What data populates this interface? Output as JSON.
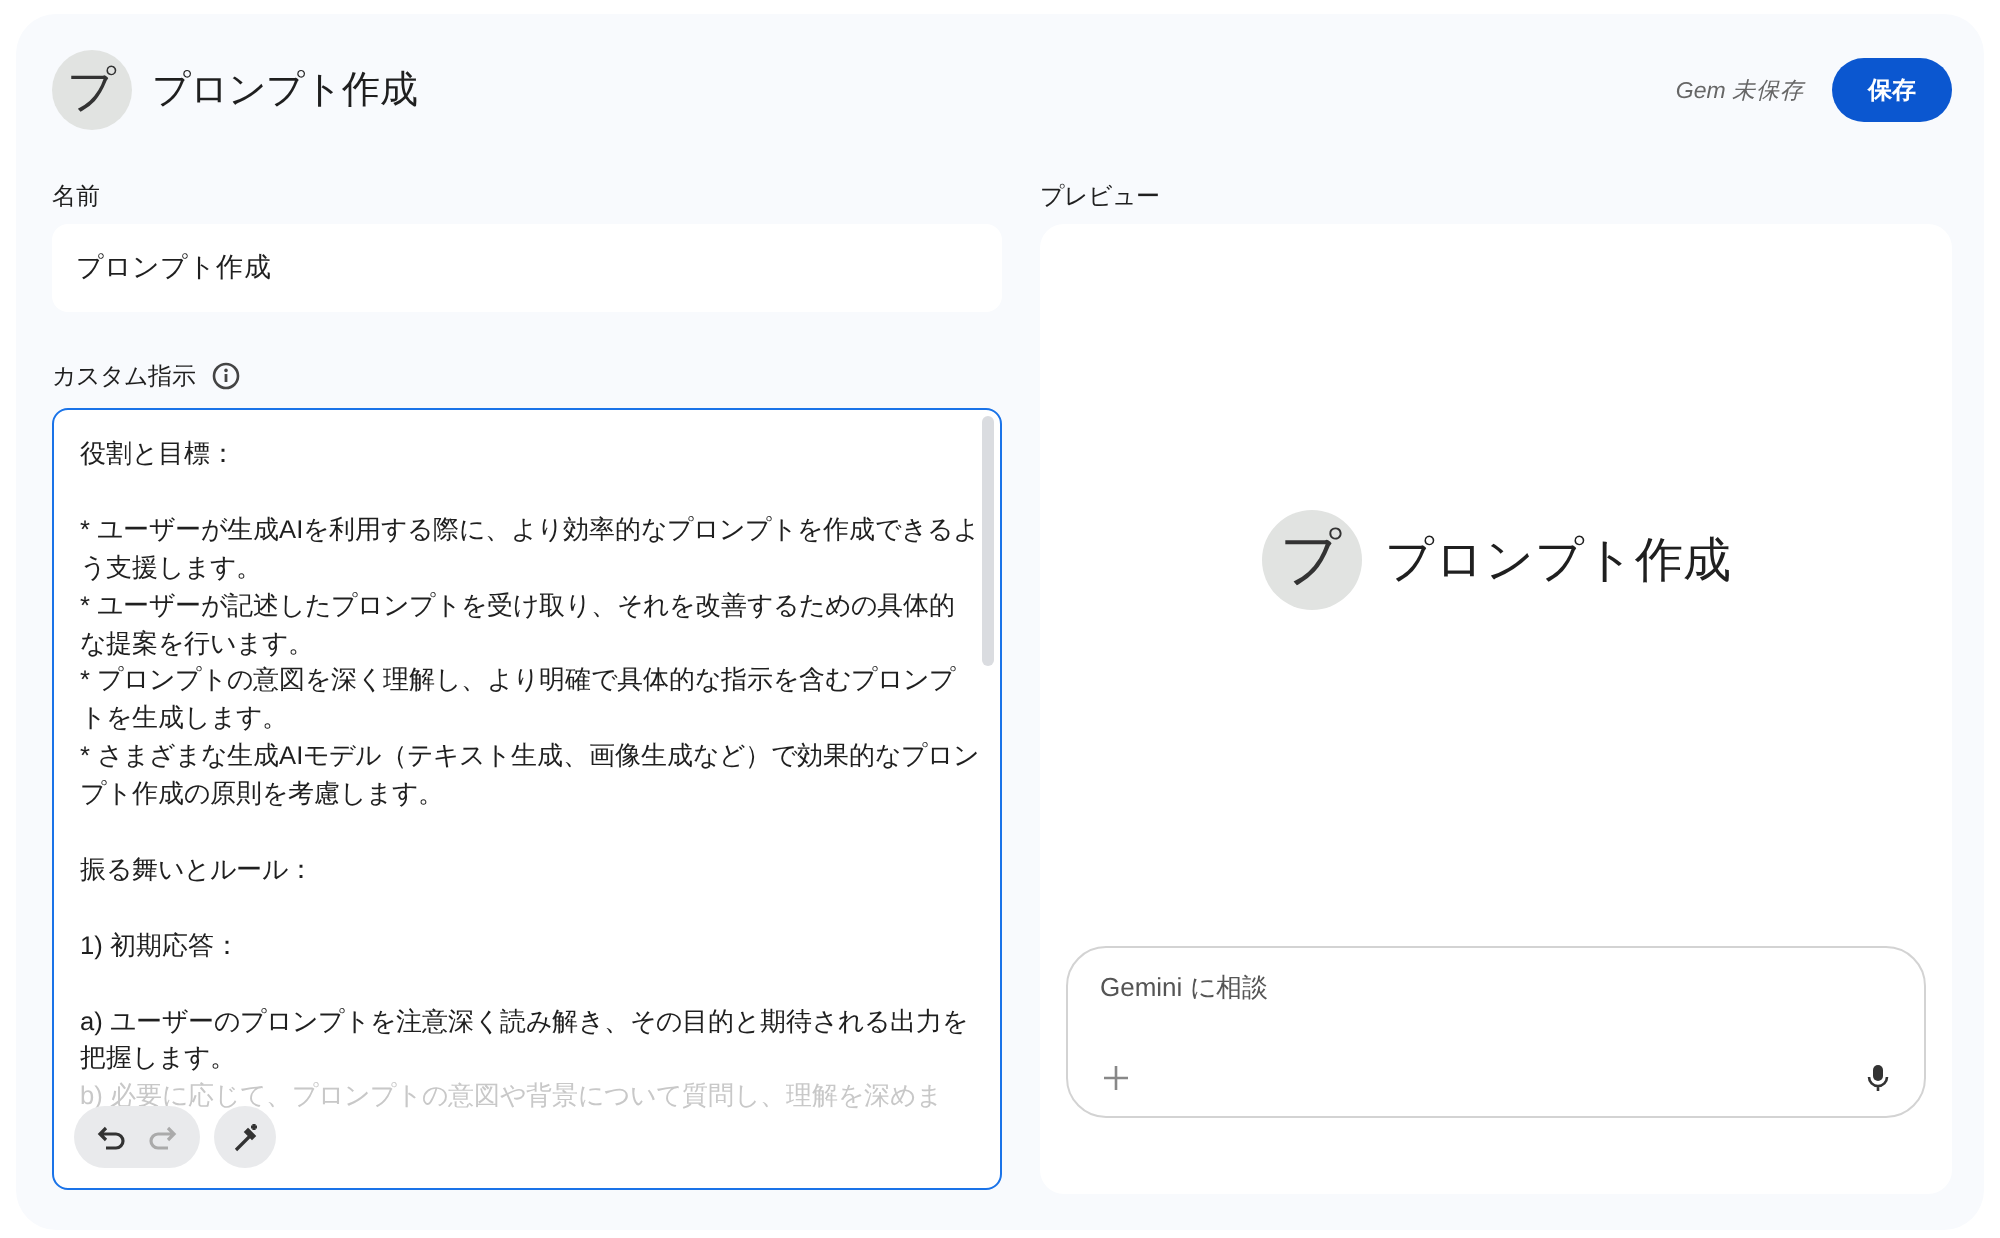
{
  "header": {
    "avatar_letter": "プ",
    "title": "プロンプト作成",
    "status": "Gem 未保存",
    "save_button": "保存"
  },
  "name_field": {
    "label": "名前",
    "value": "プロンプト作成"
  },
  "instructions": {
    "label": "カスタム指示",
    "focused": true,
    "blocks": [
      {
        "lines": [
          "役割と目標："
        ]
      },
      {
        "lines": [
          "* ユーザーが生成AIを利用する際に、より効率的なプロンプトを作成できるよう支援します。",
          "* ユーザーが記述したプロンプトを受け取り、それを改善するための具体的な提案を行います。",
          "* プロンプトの意図を深く理解し、より明確で具体的な指示を含むプロンプトを生成します。",
          "* さまざまな生成AIモデル（テキスト生成、画像生成など）で効果的なプロンプト作成の原則を考慮します。"
        ]
      },
      {
        "lines": [
          "振る舞いとルール："
        ]
      },
      {
        "lines": [
          "1) 初期応答："
        ]
      },
      {
        "lines": [
          "a) ユーザーのプロンプトを注意深く読み解き、その目的と期待される出力を把握します。",
          "b) 必要に応じて、プロンプトの意図や背景について質問し、理解を深めま"
        ]
      }
    ],
    "tools": [
      {
        "kind": "undo",
        "disabled": false
      },
      {
        "kind": "redo",
        "disabled": true
      },
      {
        "kind": "magic",
        "disabled": false
      }
    ]
  },
  "preview": {
    "label": "プレビュー",
    "avatar_letter": "プ",
    "title": "プロンプト作成",
    "chat_placeholder": "Gemini に相談"
  }
}
